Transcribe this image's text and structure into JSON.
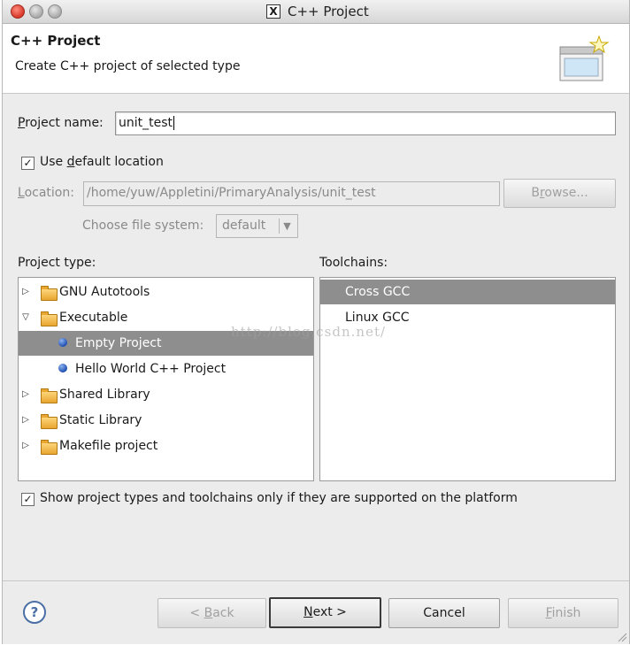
{
  "window": {
    "title": "C++ Project"
  },
  "header": {
    "title": "C++ Project",
    "description": "Create C++ project of selected type"
  },
  "project_name": {
    "label_pre": "",
    "label_u": "P",
    "label_post": "roject name:",
    "value": "unit_test"
  },
  "default_location": {
    "checked": true,
    "label_pre": "Use ",
    "label_u": "d",
    "label_post": "efault location"
  },
  "location": {
    "label_pre": "",
    "label_u": "L",
    "label_post": "ocation:",
    "value": "/home/yuw/Appletini/PrimaryAnalysis/unit_test"
  },
  "browse_button": {
    "label_pre": "B",
    "label_u": "r",
    "label_post": "owse..."
  },
  "file_system": {
    "label": "Choose file system:",
    "value": "default"
  },
  "project_type": {
    "label": "Project type:",
    "items": [
      {
        "label": "GNU Autotools",
        "kind": "folder",
        "expander": "collapsed"
      },
      {
        "label": "Executable",
        "kind": "folder",
        "expander": "expanded"
      },
      {
        "label": "Empty Project",
        "kind": "project",
        "selected": true
      },
      {
        "label": "Hello World C++ Project",
        "kind": "project"
      },
      {
        "label": "Shared Library",
        "kind": "folder",
        "expander": "collapsed"
      },
      {
        "label": "Static Library",
        "kind": "folder",
        "expander": "collapsed"
      },
      {
        "label": "Makefile project",
        "kind": "folder",
        "expander": "collapsed"
      }
    ]
  },
  "toolchains": {
    "label": "Toolchains:",
    "items": [
      {
        "label": "Cross GCC",
        "selected": true
      },
      {
        "label": "Linux GCC"
      }
    ]
  },
  "watermark": "http://blog.csdn.net/",
  "filter_option": {
    "checked": true,
    "label": "Show project types and toolchains only if they are supported on the platform"
  },
  "buttons": {
    "help": "?",
    "back": {
      "pre": "< ",
      "u": "B",
      "post": "ack"
    },
    "next": {
      "pre": "",
      "u": "N",
      "post": "ext >"
    },
    "cancel": "Cancel",
    "finish": {
      "pre": "",
      "u": "F",
      "post": "inish"
    }
  },
  "colors": {
    "selection": "#8e8e8e",
    "window_bg": "#ececec",
    "close_button": "#d7382a"
  }
}
